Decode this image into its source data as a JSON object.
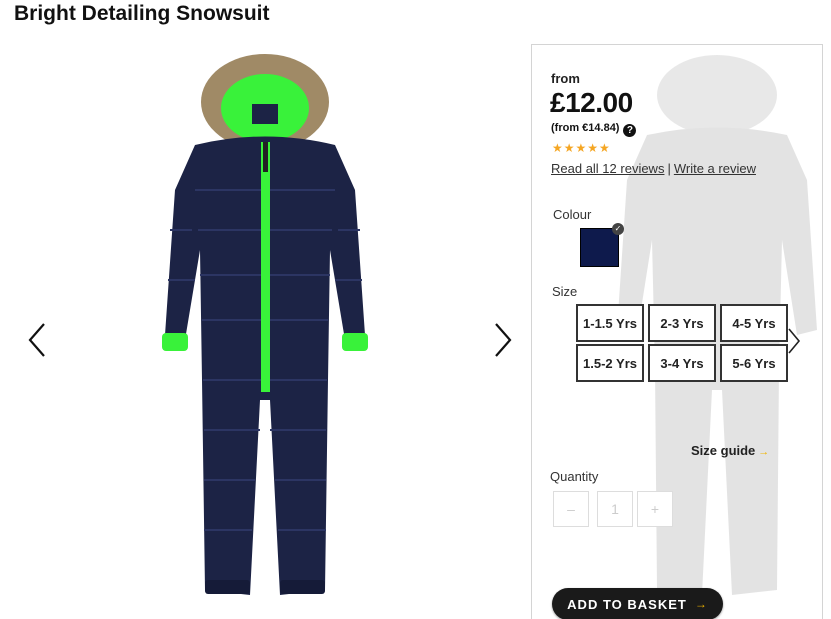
{
  "product": {
    "title": "Bright Detailing Snowsuit"
  },
  "gallery": {
    "prev_icon": "chevron-left-icon",
    "next_icon": "chevron-right-icon",
    "image_subject": "snowsuit"
  },
  "pricing": {
    "from_label": "from",
    "price": "£12.00",
    "alt_price": "(from €14.84)",
    "help_icon_text": "?"
  },
  "reviews": {
    "stars": "★★★★★",
    "rating": 5,
    "read_link": "Read all 12 reviews",
    "separator": "|",
    "write_link": "Write a review"
  },
  "colour": {
    "label": "Colour",
    "selected_swatch": "#0e1a4c",
    "check_icon": "✓"
  },
  "size": {
    "label": "Size",
    "options": [
      "1-1.5 Yrs",
      "2-3 Yrs",
      "4-5 Yrs",
      "1.5-2 Yrs",
      "3-4 Yrs",
      "5-6 Yrs"
    ],
    "guide_label": "Size guide",
    "guide_arrow": "→"
  },
  "quantity": {
    "label": "Quantity",
    "minus": "–",
    "value": "1",
    "plus": "+"
  },
  "basket": {
    "label": "ADD TO BASKET",
    "arrow": "→"
  },
  "colors": {
    "suit_navy": "#1c2345",
    "accent_green": "#39f23a",
    "fur": "#a08a66",
    "button_dark": "#1a1a1a",
    "star_gold": "#f5a623"
  }
}
